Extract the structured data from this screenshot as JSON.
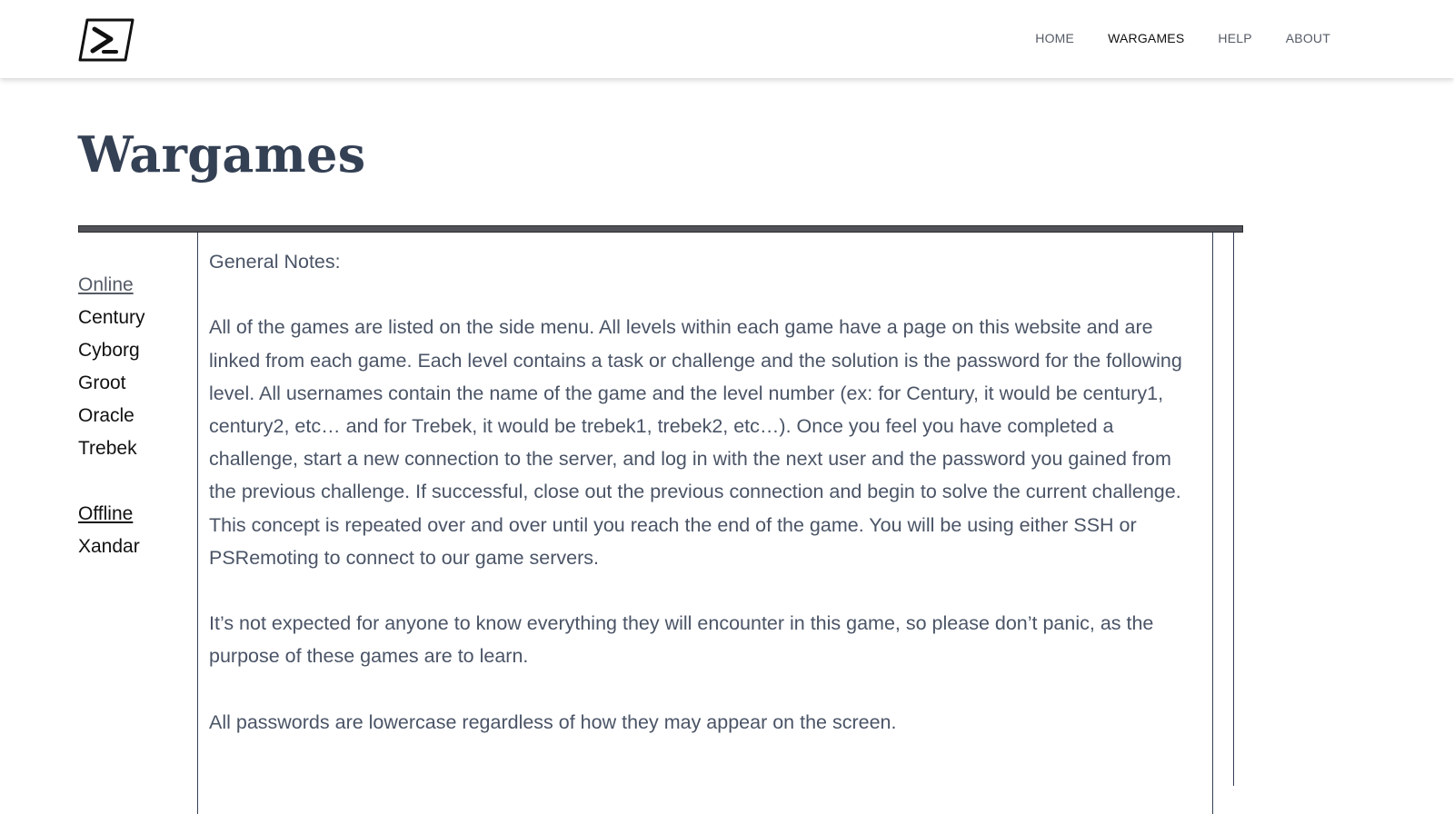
{
  "header": {
    "logo_icon": "powershell-prompt-icon",
    "nav": [
      {
        "label": "HOME",
        "active": false
      },
      {
        "label": "WARGAMES",
        "active": true
      },
      {
        "label": "HELP",
        "active": false
      },
      {
        "label": "ABOUT",
        "active": false
      }
    ]
  },
  "page": {
    "title": "Wargames"
  },
  "sidebar": {
    "online_heading": "Online",
    "online_items": [
      "Century",
      "Cyborg",
      "Groot",
      "Oracle",
      "Trebek"
    ],
    "offline_heading": "Offline",
    "offline_items": [
      "Xandar"
    ]
  },
  "main": {
    "paragraphs": [
      "General Notes:",
      "All of the games are listed on the side menu. All levels within each game have a page on this website and are linked from each game. Each level contains a task or challenge and the solution is the password for the following level. All usernames contain the name of the game and the level number (ex: for Century, it would be century1, century2, etc… and for Trebek, it would be trebek1, trebek2, etc…). Once you feel you have completed a challenge, start a new connection to the server, and log in with the next user and the password you gained from the previous challenge. If successful, close out the previous connection and begin to solve the current challenge. This concept is repeated over and over until you reach the end of the game. You will be using either SSH or PSRemoting to connect to our game servers.",
      "It’s not expected for anyone to know everything they will encounter in this game, so please don’t panic, as the purpose of these games are to learn.",
      "All passwords are lowercase regardless of how they may appear on the screen."
    ]
  },
  "colors": {
    "title": "#344054",
    "body_text": "#4a5466",
    "rule": "#505258"
  }
}
